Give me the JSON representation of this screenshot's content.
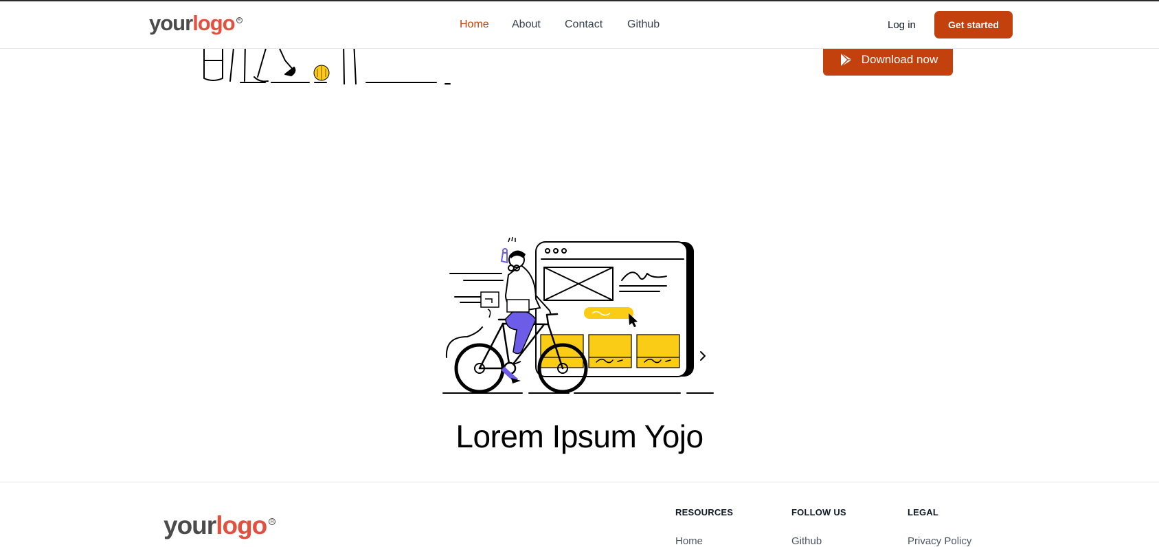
{
  "brand": {
    "logo_your": "your",
    "logo_mark": "logo",
    "logo_reg": "R",
    "accent_color": "#c2410c"
  },
  "nav": {
    "links": [
      {
        "label": "Home",
        "active": true
      },
      {
        "label": "About",
        "active": false
      },
      {
        "label": "Contact",
        "active": false
      },
      {
        "label": "Github",
        "active": false
      }
    ],
    "login_label": "Log in",
    "cta_label": "Get started"
  },
  "hero": {
    "download_label": "Download now",
    "download_icon": "play-store-icon"
  },
  "feature": {
    "illustration": "cyclist-website-illustration",
    "headline": "Lorem Ipsum Yojo"
  },
  "footer": {
    "columns": [
      {
        "heading": "RESOURCES",
        "links": [
          "Home"
        ]
      },
      {
        "heading": "FOLLOW US",
        "links": [
          "Github"
        ]
      },
      {
        "heading": "LEGAL",
        "links": [
          "Privacy Policy"
        ]
      }
    ]
  }
}
